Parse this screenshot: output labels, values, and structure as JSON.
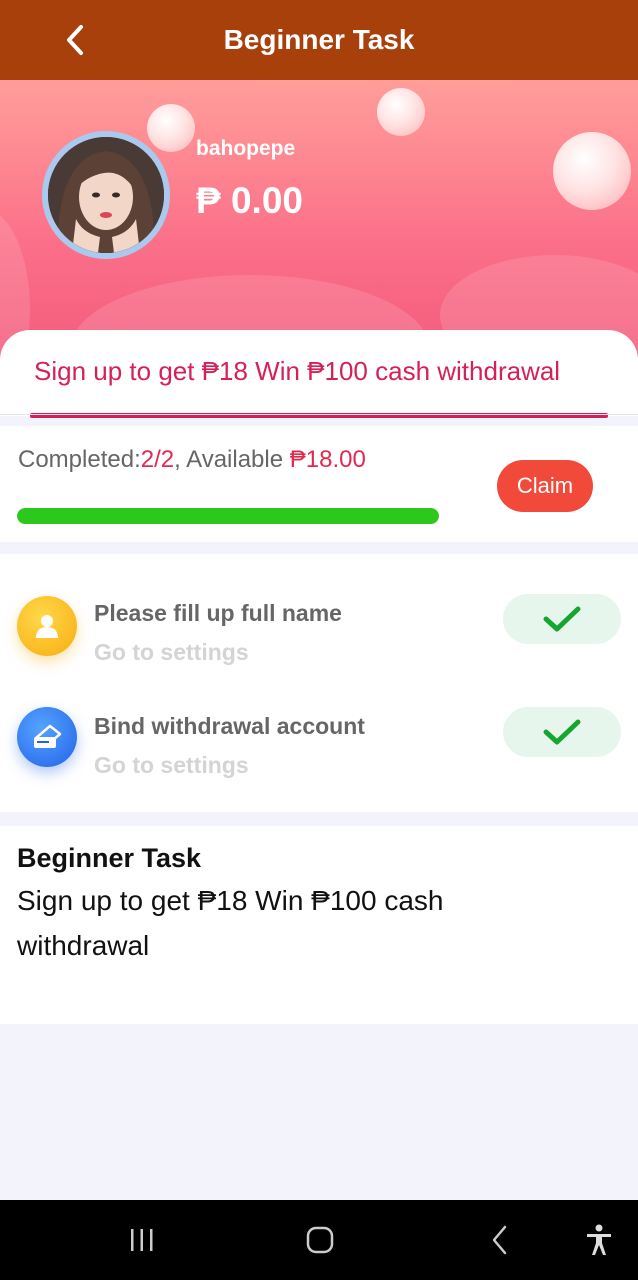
{
  "header": {
    "title": "Beginner Task"
  },
  "profile": {
    "username": "bahopepe",
    "balance": "₱ 0.00"
  },
  "tab": {
    "label": "Sign up to get ₱18 Win ₱100 cash withdrawal"
  },
  "progress": {
    "completed_label": "Completed:",
    "completed_value": "2/2",
    "separator": ", ",
    "available_label": "Available ",
    "available_value": "₱18.00",
    "fraction": 1.0,
    "claim_label": "Claim"
  },
  "tasks": [
    {
      "title": "Please fill up full name",
      "subtitle": "Go to settings",
      "icon": "user-icon",
      "done": true
    },
    {
      "title": "Bind withdrawal account",
      "subtitle": "Go to settings",
      "icon": "bank-card-icon",
      "done": true
    }
  ],
  "description": {
    "title": "Beginner Task",
    "body": "Sign up to get ₱18 Win ₱100 cash withdrawal"
  },
  "nav": {
    "buttons": [
      "recent-apps-icon",
      "home-icon",
      "back-icon",
      "accessibility-icon"
    ]
  },
  "colors": {
    "header_bg": "#a8400c",
    "accent_red": "#e3294f",
    "progress_green": "#2dc81c",
    "claim_bg": "#f1493a"
  }
}
